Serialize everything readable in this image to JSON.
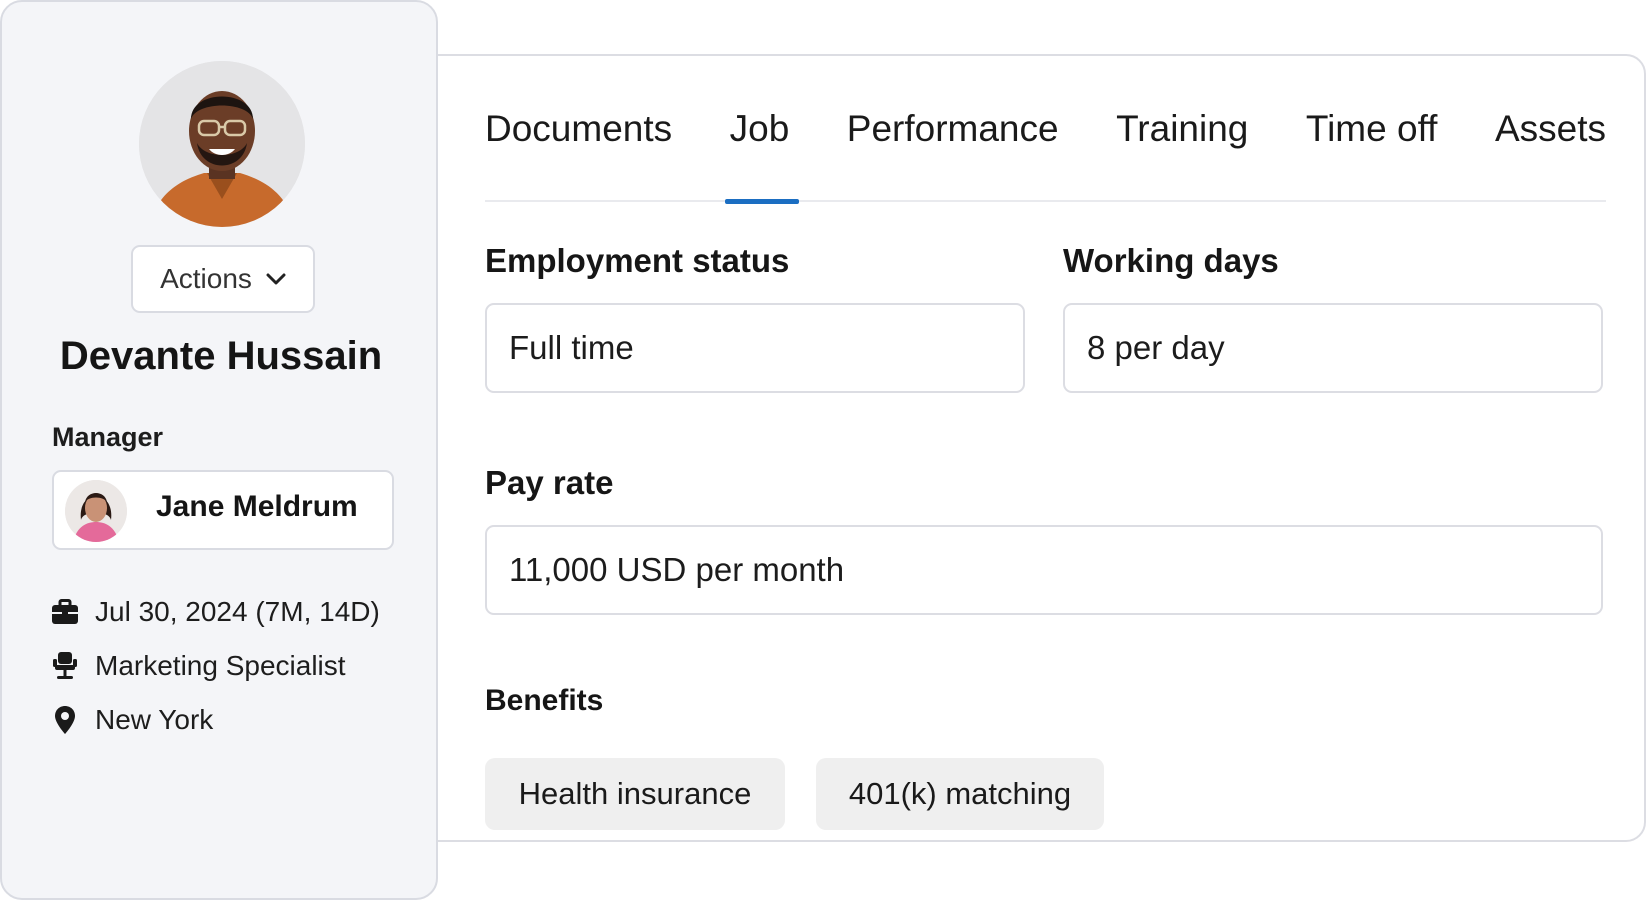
{
  "profile": {
    "name": "Devante Hussain",
    "actions_label": "Actions",
    "manager_label": "Manager",
    "manager_name": "Jane Meldrum",
    "details": [
      {
        "icon": "briefcase-icon",
        "text": "Jul 30, 2024 (7M, 14D)"
      },
      {
        "icon": "office-chair-icon",
        "text": "Marketing Specialist"
      },
      {
        "icon": "location-pin-icon",
        "text": "New York"
      }
    ]
  },
  "tabs": [
    {
      "label": "Documents",
      "active": false
    },
    {
      "label": "Job",
      "active": true
    },
    {
      "label": "Performance",
      "active": false
    },
    {
      "label": "Training",
      "active": false
    },
    {
      "label": "Time off",
      "active": false
    },
    {
      "label": "Assets",
      "active": false
    }
  ],
  "job": {
    "employment_status": {
      "label": "Employment status",
      "value": "Full time"
    },
    "working_days": {
      "label": "Working days",
      "value": "8 per day"
    },
    "pay_rate": {
      "label": "Pay rate",
      "value": "11,000 USD per month"
    },
    "benefits": {
      "label": "Benefits",
      "items": [
        "Health insurance",
        "401(k) matching"
      ]
    }
  },
  "colors": {
    "accent": "#1b6ec2",
    "card_bg": "#f4f5f8",
    "border": "#dcdde3",
    "chip_bg": "#efefef"
  }
}
